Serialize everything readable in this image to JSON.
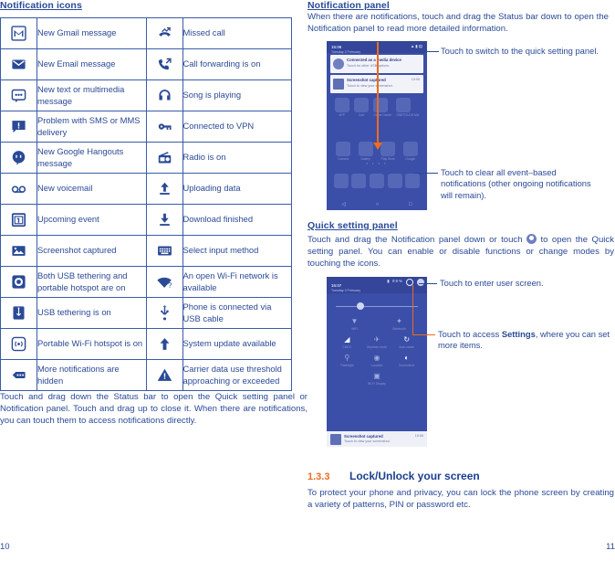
{
  "left": {
    "title": "Notification icons",
    "table_rows": [
      {
        "icon1": "gmail-icon",
        "label1": "New Gmail message",
        "icon2": "missed-call-icon",
        "label2": "Missed call"
      },
      {
        "icon1": "email-icon",
        "label1": "New Email message",
        "icon2": "call-forwarding-icon",
        "label2": "Call forwarding is on"
      },
      {
        "icon1": "sms-mms-icon",
        "label1": "New text or multimedia message",
        "icon2": "headphone-icon",
        "label2": "Song is playing"
      },
      {
        "icon1": "sms-problem-icon",
        "label1": "Problem with SMS or MMS delivery",
        "icon2": "vpn-key-icon",
        "label2": "Connected to VPN"
      },
      {
        "icon1": "hangouts-icon",
        "label1": "New Google Hangouts message",
        "icon2": "radio-icon",
        "label2": "Radio is on"
      },
      {
        "icon1": "voicemail-icon",
        "label1": "New voicemail",
        "icon2": "upload-icon",
        "label2": "Uploading data"
      },
      {
        "icon1": "calendar-event-icon",
        "label1": "Upcoming event",
        "icon2": "download-icon",
        "label2": "Download finished"
      },
      {
        "icon1": "screenshot-icon",
        "label1": "Screenshot captured",
        "icon2": "keyboard-icon",
        "label2": "Select input method"
      },
      {
        "icon1": "usb-tethering-hotspot-icon",
        "label1": "Both USB tethering and portable hotspot are on",
        "icon2": "open-wifi-icon",
        "label2": "An open Wi-Fi network is available"
      },
      {
        "icon1": "usb-tethering-icon",
        "label1": "USB tethering is on",
        "icon2": "usb-cable-icon",
        "label2": "Phone is connected via USB cable"
      },
      {
        "icon1": "wifi-hotspot-icon",
        "label1": "Portable Wi-Fi hotspot is on",
        "icon2": "system-update-icon",
        "label2": "System update available"
      },
      {
        "icon1": "more-notifications-icon",
        "label1": "More notifications are hidden",
        "icon2": "warning-icon",
        "label2": "Carrier data use threshold approaching or exceeded"
      }
    ],
    "paragraph": "Touch and drag down the Status bar to open the Quick setting panel or Notification panel. Touch and drag up to close it. When there are notifications, you can touch them to access notifications directly.",
    "page_number": "10"
  },
  "right": {
    "title": "Notification panel",
    "paragraph1": "When there are notifications, touch and drag the Status bar down to open the Notification panel to read more detailed information.",
    "annotation_quick_setting": "Touch to switch to the quick setting panel.",
    "annotation_clear": "Touch to clear all event–based notifications (other ongoing notifications will remain).",
    "quick_title": "Quick setting panel",
    "paragraph2_part1": "Touch and drag the Notification panel down or touch",
    "paragraph2_part2": "to open the Quick setting panel. You can enable or disable functions or change modes by touching the icons.",
    "annotation_user": "Touch to enter user screen.",
    "annotation_settings_pre": "Touch to access ",
    "annotation_settings_bold": "Settings",
    "annotation_settings_post": ", where you can set more items.",
    "section_number": "1.3.3",
    "section_title": "Lock/Unlock your screen",
    "paragraph3": "To protect your phone and privacy, you can lock the phone screen by creating a variety of patterns, PIN or password etc.",
    "page_number": "11"
  },
  "phone_notification": {
    "time": "15:06",
    "date": "Tuesday 3 February",
    "sys_icons": "▲▮▤",
    "notifications": [
      {
        "title": "Connected as a media device",
        "subtitle": "Touch for other USB options.",
        "time": ""
      },
      {
        "title": "Screenshot captured",
        "subtitle": "Touch to view your screenshot.",
        "time": "15:06"
      }
    ],
    "app_row1": [
      {
        "label": "APP"
      },
      {
        "label": "Cart"
      },
      {
        "label": "Game Center"
      },
      {
        "label": "ONETOUCH Mix"
      }
    ],
    "app_row2": [
      {
        "label": "Camera"
      },
      {
        "label": "Gallery"
      },
      {
        "label": "Play Store"
      },
      {
        "label": "Google"
      }
    ],
    "dock": [
      {
        "label": "Phone"
      },
      {
        "label": "Contacts"
      },
      {
        "label": "Apps"
      },
      {
        "label": "Messaging"
      },
      {
        "label": "Browser"
      }
    ],
    "nav": [
      "◁",
      "○",
      "□"
    ]
  },
  "phone_quicksettings": {
    "time": "15:07",
    "date": "Tuesday 3 February",
    "sys_icons": "▮ 99%",
    "gear_icon": "gear-icon",
    "user_icon": "user-icon",
    "tiles": [
      [
        {
          "icon": "wifi-icon",
          "label": "WiFi",
          "on": false
        },
        {
          "icon": "bluetooth-icon",
          "label": "Bluetooth",
          "on": false
        }
      ],
      [
        {
          "icon": "signal-icon",
          "label": "CMCC",
          "on": true
        },
        {
          "icon": "airplane-icon",
          "label": "Airplane mode",
          "on": false
        },
        {
          "icon": "autorotate-icon",
          "label": "Auto-rotate",
          "on": true
        }
      ],
      [
        {
          "icon": "flashlight-icon",
          "label": "Flashlight",
          "on": false
        },
        {
          "icon": "location-icon",
          "label": "Location",
          "on": false
        },
        {
          "icon": "invertcolor-icon",
          "label": "Screenshot",
          "on": true
        }
      ],
      [
        {
          "icon": "cast-icon",
          "label": "Wi-Fi Display",
          "on": false
        }
      ]
    ],
    "bottom_notification": {
      "title": "Screenshot captured",
      "subtitle": "Touch to view your screenshot.",
      "time": "15:06"
    }
  }
}
